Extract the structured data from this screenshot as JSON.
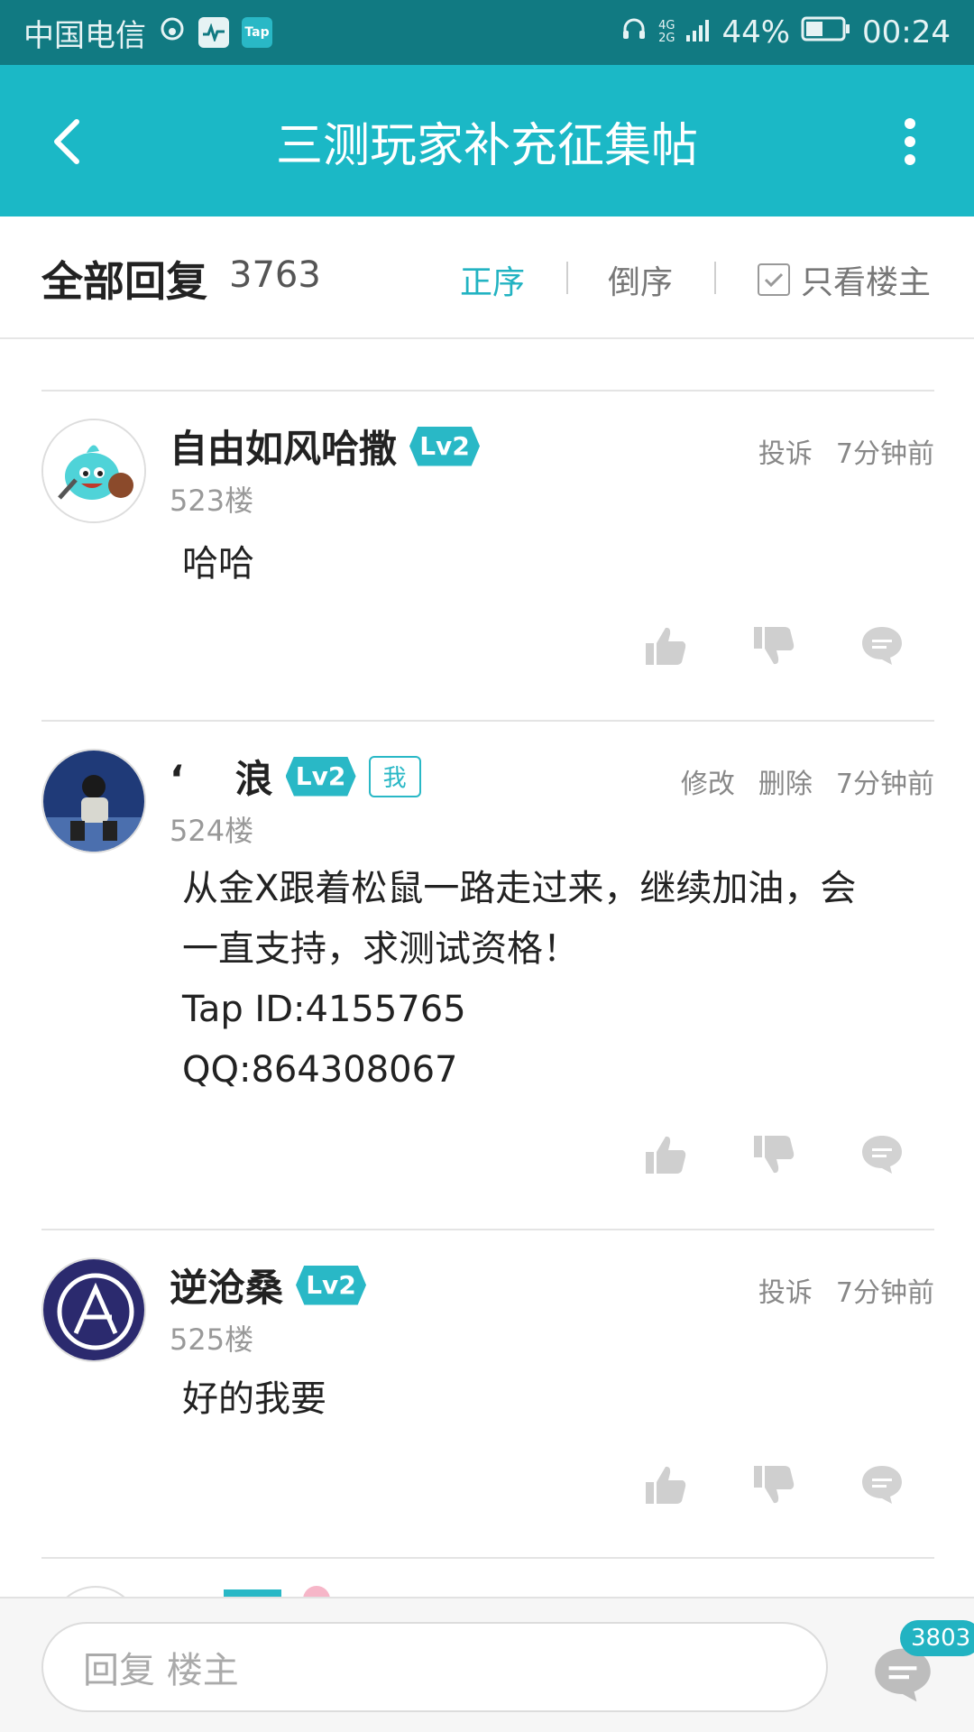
{
  "status_bar": {
    "carrier": "中国电信",
    "tap_badge": "Tap",
    "network_top": "4G",
    "network_bottom": "2G",
    "battery": "44%",
    "time": "00:24"
  },
  "header": {
    "title": "三测玩家补充征集帖"
  },
  "sort_bar": {
    "all_replies_label": "全部回复",
    "reply_count": "3763",
    "sort_positive": "正序",
    "sort_reverse": "倒序",
    "only_op": "只看楼主"
  },
  "posts": [
    {
      "username": "自由如风哈撒",
      "level": "Lv2",
      "floor": "523楼",
      "actions": [
        "投诉"
      ],
      "time": "7分钟前",
      "content": [
        "哈哈"
      ]
    },
    {
      "username": "‘　 浪",
      "level": "Lv2",
      "me_badge": "我",
      "floor": "524楼",
      "actions": [
        "修改",
        "删除"
      ],
      "time": "7分钟前",
      "content": [
        "从金X跟着松鼠一路走过来，继续加油，会",
        "一直支持，求测试资格！",
        "Tap ID:4155765",
        "QQ:864308067"
      ]
    },
    {
      "username": "逆沧桑",
      "level": "Lv2",
      "floor": "525楼",
      "actions": [
        "投诉"
      ],
      "time": "7分钟前",
      "content": [
        "好的我要"
      ]
    }
  ],
  "bottom_bar": {
    "reply_placeholder": "回复  楼主",
    "comment_count": "3803"
  },
  "colors": {
    "status_bar": "#117a82",
    "header": "#1bb8c6",
    "accent": "#22b3c2"
  },
  "icons": [
    "back-arrow-icon",
    "more-vertical-icon",
    "thumb-up-icon",
    "thumb-down-icon",
    "comment-bubble-icon",
    "checkbox-icon"
  ]
}
